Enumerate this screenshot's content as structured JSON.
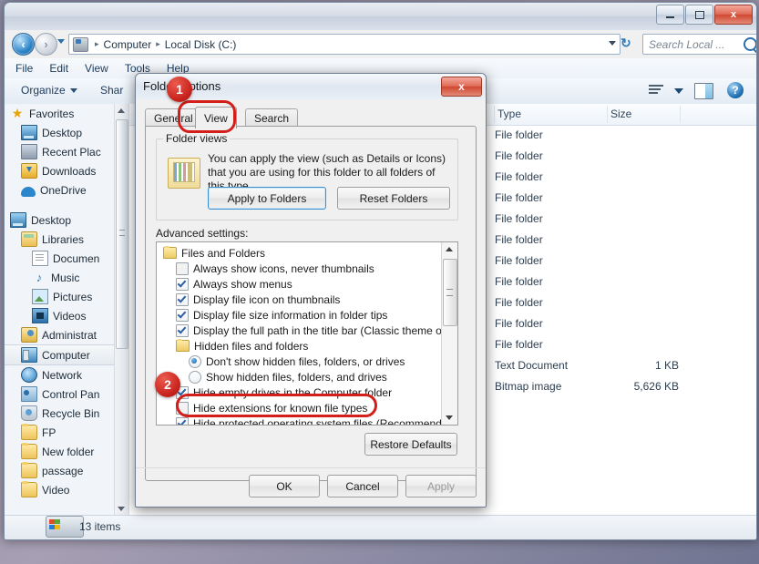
{
  "window": {
    "title": "Local Disk (C:)",
    "controls": {
      "minimize": "—",
      "maximize": "▫",
      "close": "x"
    }
  },
  "addressbar": {
    "breadcrumbs": [
      "Computer",
      "Local Disk (C:)"
    ],
    "separator": "▸",
    "refresh_label": "↻",
    "dropdown": "▾"
  },
  "search": {
    "placeholder": "Search Local ...",
    "icon": "search-icon"
  },
  "menubar": {
    "items": [
      "File",
      "Edit",
      "View",
      "Tools",
      "Help"
    ]
  },
  "toolbar": {
    "organize_label": "Organize",
    "share_label": "Shar",
    "view_icon": "list-view-icon",
    "pane_icon": "preview-pane-icon",
    "help_icon": "help-icon"
  },
  "navpane": {
    "items": [
      {
        "label": "Favorites",
        "icon": "star-icon",
        "indent": 0,
        "selected": false
      },
      {
        "label": "Desktop",
        "icon": "monitor-icon",
        "indent": 1,
        "selected": false
      },
      {
        "label": "Recent Plac",
        "icon": "recent-places-icon",
        "indent": 1,
        "selected": false
      },
      {
        "label": "Downloads",
        "icon": "downloads-icon",
        "indent": 1,
        "selected": false
      },
      {
        "label": "OneDrive",
        "icon": "cloud-icon",
        "indent": 1,
        "selected": false
      },
      {
        "label": "",
        "icon": "",
        "indent": 0,
        "selected": false
      },
      {
        "label": "Desktop",
        "icon": "monitor-icon",
        "indent": 0,
        "selected": false
      },
      {
        "label": "Libraries",
        "icon": "library-icon",
        "indent": 1,
        "selected": false
      },
      {
        "label": "Documen",
        "icon": "document-icon",
        "indent": 2,
        "selected": false
      },
      {
        "label": "Music",
        "icon": "music-icon",
        "indent": 2,
        "selected": false
      },
      {
        "label": "Pictures",
        "icon": "picture-icon",
        "indent": 2,
        "selected": false
      },
      {
        "label": "Videos",
        "icon": "video-icon",
        "indent": 2,
        "selected": false
      },
      {
        "label": "Administrat",
        "icon": "user-icon",
        "indent": 1,
        "selected": false
      },
      {
        "label": "Computer",
        "icon": "computer-icon",
        "indent": 1,
        "selected": true
      },
      {
        "label": "Network",
        "icon": "network-icon",
        "indent": 1,
        "selected": false
      },
      {
        "label": "Control Pan",
        "icon": "control-panel-icon",
        "indent": 1,
        "selected": false
      },
      {
        "label": "Recycle Bin",
        "icon": "recycle-bin-icon",
        "indent": 1,
        "selected": false
      },
      {
        "label": "FP",
        "icon": "folder-icon",
        "indent": 1,
        "selected": false
      },
      {
        "label": "New folder",
        "icon": "folder-icon",
        "indent": 1,
        "selected": false
      },
      {
        "label": "passage",
        "icon": "folder-icon",
        "indent": 1,
        "selected": false
      },
      {
        "label": "Video",
        "icon": "folder-icon",
        "indent": 1,
        "selected": false
      }
    ]
  },
  "filelist": {
    "columns": [
      "Type",
      "Size"
    ],
    "rows": [
      {
        "type": "File folder",
        "size": ""
      },
      {
        "type": "File folder",
        "size": ""
      },
      {
        "type": "File folder",
        "size": ""
      },
      {
        "type": "File folder",
        "size": ""
      },
      {
        "type": "File folder",
        "size": ""
      },
      {
        "type": "File folder",
        "size": ""
      },
      {
        "type": "File folder",
        "size": ""
      },
      {
        "type": "File folder",
        "size": ""
      },
      {
        "type": "File folder",
        "size": ""
      },
      {
        "type": "File folder",
        "size": ""
      },
      {
        "type": "File folder",
        "size": ""
      },
      {
        "type": "Text Document",
        "size": "1 KB"
      },
      {
        "type": "Bitmap image",
        "size": "5,626 KB"
      }
    ]
  },
  "statusbar": {
    "count": "13 items",
    "drive_icon": "drive-icon"
  },
  "dialog": {
    "title": "Folder Options",
    "close_label": "x",
    "tabs": [
      {
        "label": "General",
        "active": false
      },
      {
        "label": "View",
        "active": true
      },
      {
        "label": "Search",
        "active": false
      }
    ],
    "folder_views": {
      "group_label": "Folder views",
      "description": "You can apply the view (such as Details or Icons) that you are using for this folder to all folders of this type.",
      "apply_button": "Apply to Folders",
      "reset_button": "Reset Folders",
      "icon": "folder-view-icon"
    },
    "advanced_label": "Advanced settings:",
    "advanced_items": [
      {
        "label": "Files and Folders",
        "kind": "folder",
        "indent": 0,
        "state": ""
      },
      {
        "label": "Always show icons, never thumbnails",
        "kind": "check",
        "indent": 1,
        "state": "off"
      },
      {
        "label": "Always show menus",
        "kind": "check",
        "indent": 1,
        "state": "on"
      },
      {
        "label": "Display file icon on thumbnails",
        "kind": "check",
        "indent": 1,
        "state": "on"
      },
      {
        "label": "Display file size information in folder tips",
        "kind": "check",
        "indent": 1,
        "state": "on"
      },
      {
        "label": "Display the full path in the title bar (Classic theme only)",
        "kind": "check",
        "indent": 1,
        "state": "on"
      },
      {
        "label": "Hidden files and folders",
        "kind": "folder",
        "indent": 1,
        "state": ""
      },
      {
        "label": "Don't show hidden files, folders, or drives",
        "kind": "radio",
        "indent": 2,
        "state": "on"
      },
      {
        "label": "Show hidden files, folders, and drives",
        "kind": "radio",
        "indent": 2,
        "state": "off"
      },
      {
        "label": "Hide empty drives in the Computer folder",
        "kind": "check",
        "indent": 1,
        "state": "on"
      },
      {
        "label": "Hide extensions for known file types",
        "kind": "check",
        "indent": 1,
        "state": "off"
      },
      {
        "label": "Hide protected operating system files (Recommended)",
        "kind": "check",
        "indent": 1,
        "state": "on"
      }
    ],
    "restore_button": "Restore Defaults",
    "ok_button": "OK",
    "cancel_button": "Cancel",
    "apply_button": "Apply"
  },
  "annotations": [
    {
      "number": "1",
      "target": "view-tab"
    },
    {
      "number": "2",
      "target": "hide-extensions-checkbox"
    }
  ],
  "colors": {
    "annotation_red": "#d31f1a",
    "accent_blue": "#3c8fd0",
    "selected_row": "#e5eaf0"
  }
}
